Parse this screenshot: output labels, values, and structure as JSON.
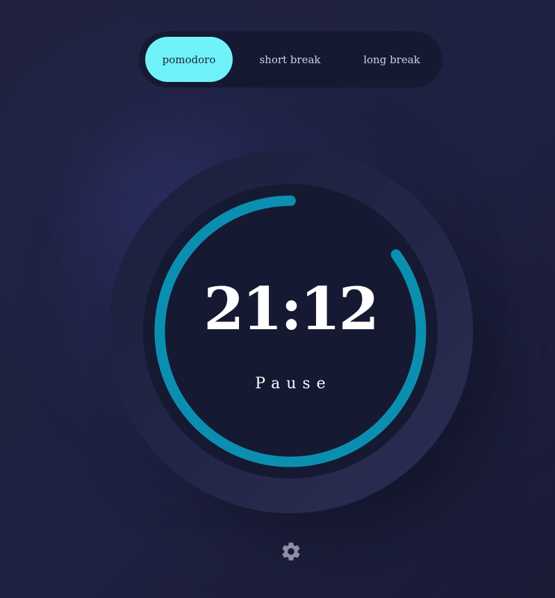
{
  "modes": {
    "pomodoro": "pomodoro",
    "short_break": "short break",
    "long_break": "long break",
    "active": "pomodoro"
  },
  "timer": {
    "time": "21:12",
    "action": "Pause",
    "progress_fraction": 0.85
  },
  "colors": {
    "background": "#1f2141",
    "panel": "#161932",
    "accent_active_tab": "#70f3f8",
    "progress": "#0b8fb0",
    "text": "#ffffff",
    "icon": "#8d8fa3"
  },
  "icons": {
    "settings": "gear-icon"
  }
}
